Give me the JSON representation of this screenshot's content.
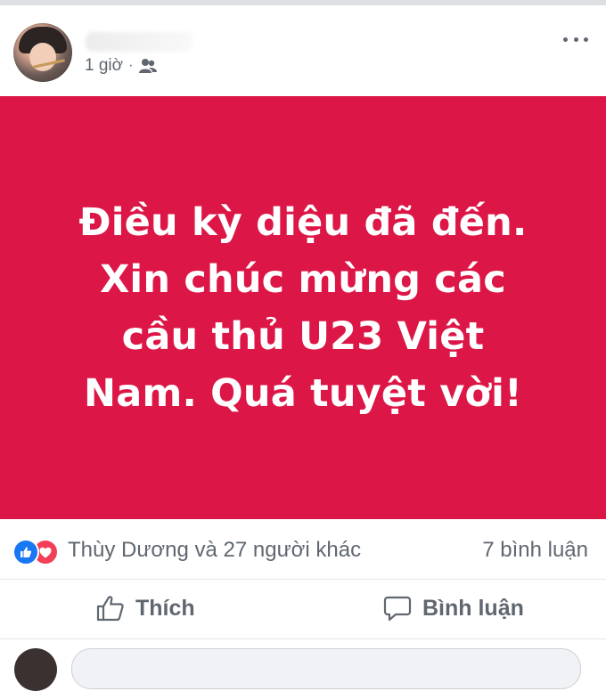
{
  "post": {
    "time": "1 giờ",
    "separator": "·",
    "privacy_icon": "friends-icon",
    "more_icon": "more-horizontal-icon"
  },
  "banner": {
    "background_color": "#dc1646",
    "text_color": "#ffffff",
    "lines": [
      "Điều kỳ diệu đã đến.",
      "Xin chúc mừng các",
      "cầu thủ U23 Việt",
      "Nam. Quá tuyệt vời!"
    ]
  },
  "reactions": {
    "icons": [
      "like-reaction-icon",
      "love-reaction-icon"
    ],
    "summary": "Thùy Dương và 27 người khác",
    "comments": "7 bình luận"
  },
  "actions": {
    "like_label": "Thích",
    "comment_label": "Bình luận"
  },
  "colors": {
    "like_blue": "#1877f2",
    "love_red": "#f33e58",
    "secondary_text": "#606770"
  }
}
